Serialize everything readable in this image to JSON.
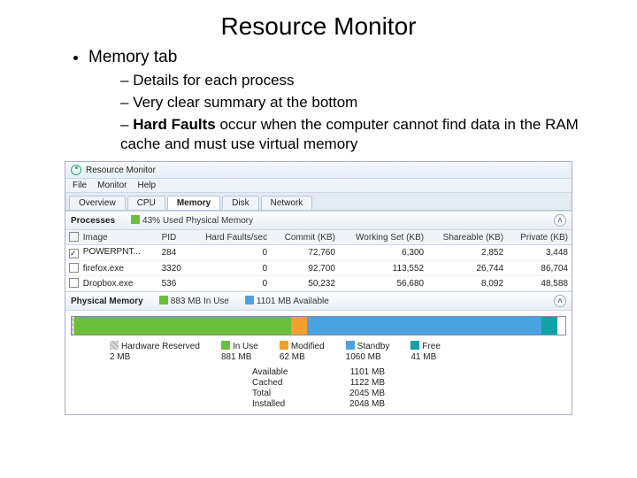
{
  "slide": {
    "title": "Resource Monitor",
    "bullet": "Memory tab",
    "sub": [
      "Details for each process",
      "Very clear summary at the bottom",
      "Hard Faults occur when the computer cannot find data in the RAM cache and must use virtual memory"
    ],
    "sub_bold_prefix": "Hard Faults"
  },
  "app": {
    "title": "Resource Monitor",
    "menu": [
      "File",
      "Monitor",
      "Help"
    ],
    "tabs": [
      "Overview",
      "CPU",
      "Memory",
      "Disk",
      "Network"
    ],
    "active_tab": "Memory",
    "processes": {
      "header": "Processes",
      "summary_label": "43% Used Physical Memory",
      "columns": [
        "Image",
        "PID",
        "Hard Faults/sec",
        "Commit (KB)",
        "Working Set (KB)",
        "Shareable (KB)",
        "Private (KB)"
      ],
      "rows": [
        {
          "checked": true,
          "image": "POWERPNT...",
          "pid": "284",
          "hf": "0",
          "commit": "72,760",
          "ws": "6,300",
          "share": "2,852",
          "priv": "3,448"
        },
        {
          "checked": false,
          "image": "firefox.exe",
          "pid": "3320",
          "hf": "0",
          "commit": "92,700",
          "ws": "113,552",
          "share": "26,744",
          "priv": "86,704"
        },
        {
          "checked": false,
          "image": "Dropbox.exe",
          "pid": "536",
          "hf": "0",
          "commit": "50,232",
          "ws": "56,680",
          "share": "8,092",
          "priv": "48,588"
        }
      ]
    },
    "physmem": {
      "header": "Physical Memory",
      "in_use_label": "883 MB In Use",
      "available_label": "1101 MB Available",
      "legend": {
        "hw": {
          "label": "Hardware Reserved",
          "value": "2 MB"
        },
        "use": {
          "label": "In Use",
          "value": "881 MB"
        },
        "mod": {
          "label": "Modified",
          "value": "62 MB"
        },
        "stand": {
          "label": "Standby",
          "value": "1060 MB"
        },
        "free": {
          "label": "Free",
          "value": "41 MB"
        }
      },
      "summary": [
        {
          "k": "Available",
          "v": "1101 MB"
        },
        {
          "k": "Cached",
          "v": "1122 MB"
        },
        {
          "k": "Total",
          "v": "2045 MB"
        },
        {
          "k": "Installed",
          "v": "2048 MB"
        }
      ]
    }
  }
}
